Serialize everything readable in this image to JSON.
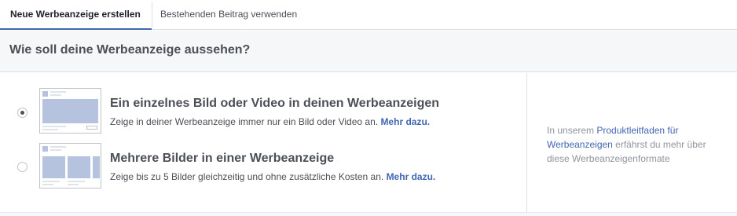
{
  "tabs": [
    {
      "label": "Neue Werbeanzeige erstellen",
      "active": true
    },
    {
      "label": "Bestehenden Beitrag verwenden",
      "active": false
    }
  ],
  "section": {
    "title": "Wie soll deine Werbeanzeige aussehen?"
  },
  "options": [
    {
      "title": "Ein einzelnes Bild oder Video in deinen Werbeanzeigen",
      "description": "Zeige in deiner Werbeanzeige immer nur ein Bild oder Video an.",
      "more_link": "Mehr dazu.",
      "selected": true
    },
    {
      "title": "Mehrere Bilder in einer Werbeanzeige",
      "description": "Zeige bis zu 5 Bilder gleichzeitig und ohne zusätzliche Kosten an.",
      "more_link": "Mehr dazu.",
      "selected": false
    }
  ],
  "help": {
    "prefix": "In unserem ",
    "link": "Produktleitfaden für Werbeanzeigen",
    "suffix": " erfährst du mehr über diese Werbeanzeigenformate"
  },
  "colors": {
    "accent": "#4267b2",
    "thumb_fill": "#b6c3df",
    "header_bg": "#f6f7f9"
  }
}
